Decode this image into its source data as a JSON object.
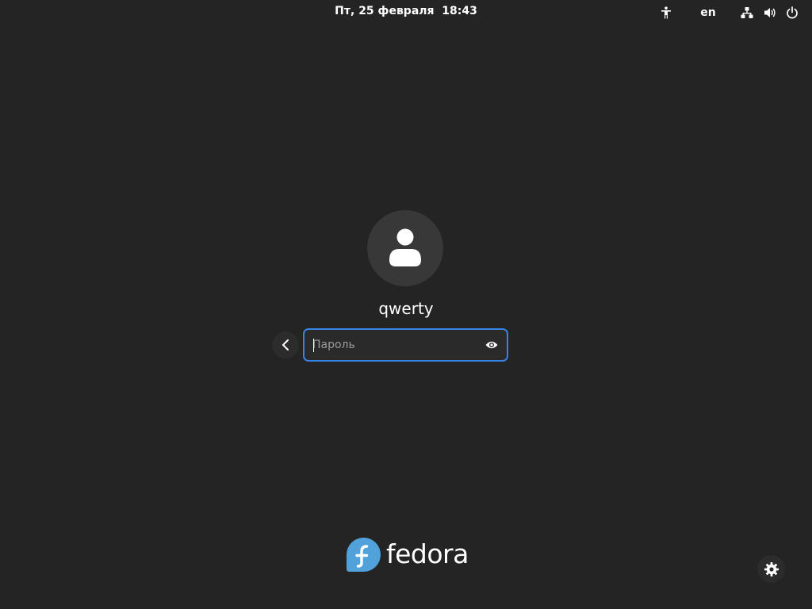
{
  "topbar": {
    "clock": "Пт, 25 февраля  18:43",
    "language": "en",
    "icons": [
      "accessibility-icon",
      "network-icon",
      "volume-icon",
      "power-icon"
    ]
  },
  "login": {
    "username": "qwerty",
    "password_placeholder": "Пароль",
    "password_value": ""
  },
  "branding": {
    "logo_text": "fedora",
    "logo_color": "#51a2da"
  },
  "colors": {
    "background": "#242424",
    "accent": "#3584e4",
    "avatar_bg": "#383838"
  }
}
